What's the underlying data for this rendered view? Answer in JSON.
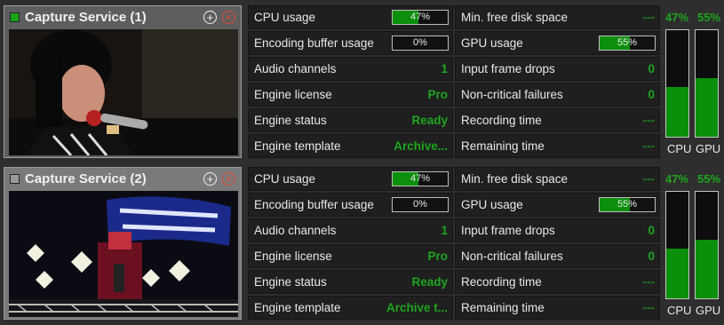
{
  "services": [
    {
      "title": "Capture Service (1)",
      "status_color": "#17a317",
      "selected": true,
      "stats": {
        "cpu_usage": {
          "label": "CPU usage",
          "value": "47%",
          "level": 0.47
        },
        "encoding_buffer": {
          "label": "Encoding buffer usage",
          "value": "0%",
          "level": 0.0
        },
        "audio_channels": {
          "label": "Audio channels",
          "value": "1"
        },
        "engine_license": {
          "label": "Engine license",
          "value": "Pro"
        },
        "engine_status": {
          "label": "Engine status",
          "value": "Ready"
        },
        "engine_template": {
          "label": "Engine template",
          "value": "Archive..."
        },
        "min_free_disk": {
          "label": "Min. free disk space",
          "value": "---"
        },
        "gpu_usage": {
          "label": "GPU usage",
          "value": "55%",
          "level": 0.55
        },
        "input_frame_drops": {
          "label": "Input frame drops",
          "value": "0"
        },
        "non_critical_failures": {
          "label": "Non-critical failures",
          "value": "0"
        },
        "recording_time": {
          "label": "Recording time",
          "value": "---"
        },
        "remaining_time": {
          "label": "Remaining time",
          "value": "---"
        }
      },
      "gauges": {
        "cpu": {
          "percent": "47%",
          "label": "CPU",
          "level": 0.47
        },
        "gpu": {
          "percent": "55%",
          "label": "GPU",
          "level": 0.55
        }
      }
    },
    {
      "title": "Capture Service (2)",
      "status_color": "#9a9a9a",
      "selected": false,
      "stats": {
        "cpu_usage": {
          "label": "CPU usage",
          "value": "47%",
          "level": 0.47
        },
        "encoding_buffer": {
          "label": "Encoding buffer usage",
          "value": "0%",
          "level": 0.0
        },
        "audio_channels": {
          "label": "Audio channels",
          "value": "1"
        },
        "engine_license": {
          "label": "Engine license",
          "value": "Pro"
        },
        "engine_status": {
          "label": "Engine status",
          "value": "Ready"
        },
        "engine_template": {
          "label": "Engine template",
          "value": "Archive t..."
        },
        "min_free_disk": {
          "label": "Min. free disk space",
          "value": "---"
        },
        "gpu_usage": {
          "label": "GPU usage",
          "value": "55%",
          "level": 0.55
        },
        "input_frame_drops": {
          "label": "Input frame drops",
          "value": "0"
        },
        "non_critical_failures": {
          "label": "Non-critical failures",
          "value": "0"
        },
        "recording_time": {
          "label": "Recording time",
          "value": "---"
        },
        "remaining_time": {
          "label": "Remaining time",
          "value": "---"
        }
      },
      "gauges": {
        "cpu": {
          "percent": "47%",
          "label": "CPU",
          "level": 0.47
        },
        "gpu": {
          "percent": "55%",
          "label": "GPU",
          "level": 0.55
        }
      }
    }
  ],
  "icons": {
    "add": "add-circle-icon",
    "close": "close-circle-icon"
  },
  "colors": {
    "accent_green": "#1fa51f",
    "bar_green": "#0c8f0c",
    "close_red": "#e04a3a"
  }
}
